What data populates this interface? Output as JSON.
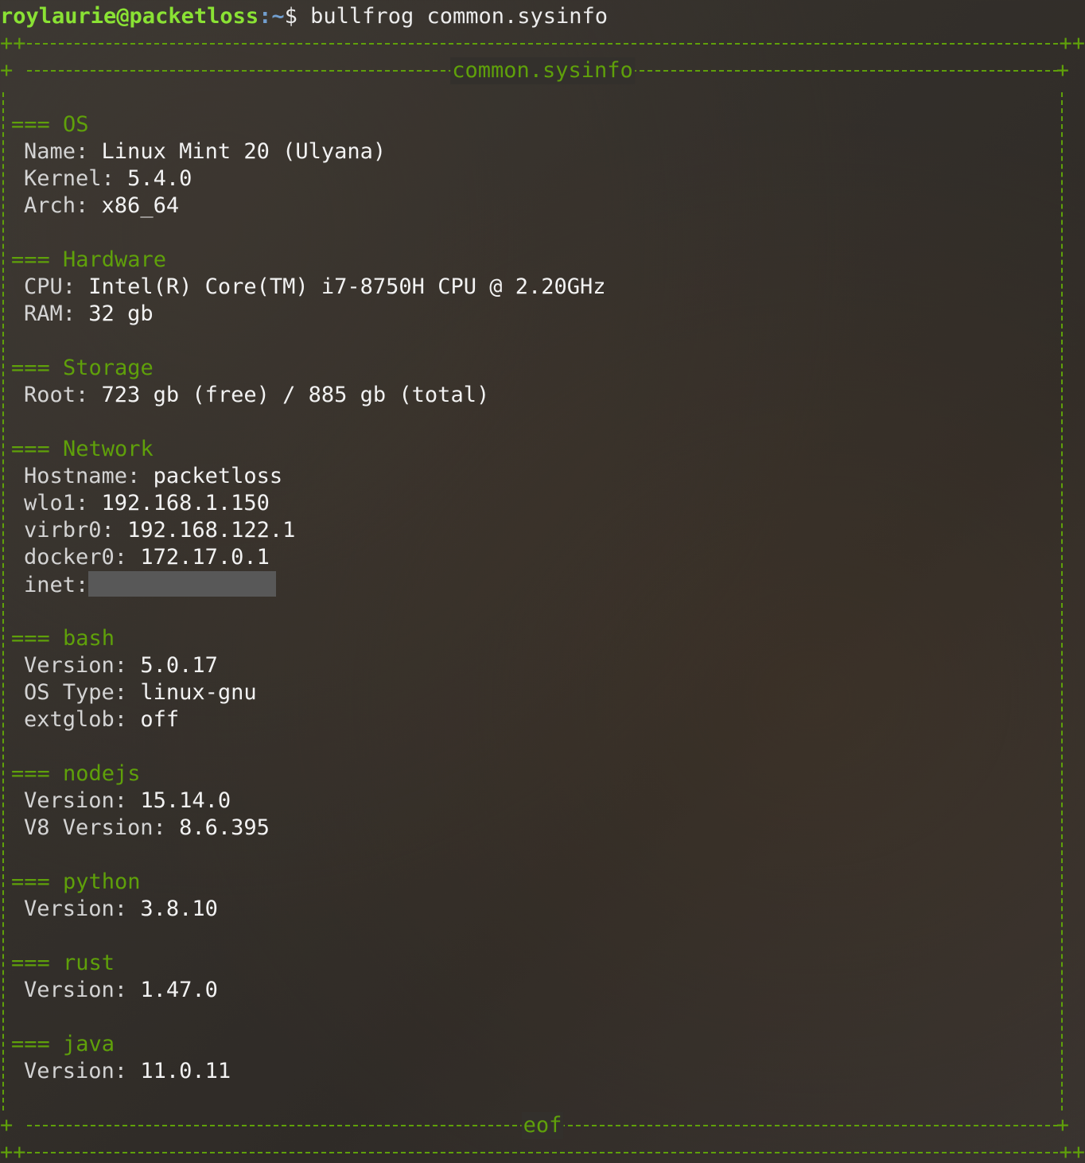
{
  "prompt": {
    "user_host": "roylaurie@packetloss",
    "path": ":~",
    "symbol": "$",
    "command": "bullfrog common.sysinfo"
  },
  "header": {
    "top_rule_left": "++",
    "top_rule_right": "++",
    "title": "common.sysinfo",
    "corner": "+"
  },
  "footer": {
    "title": "eof",
    "corner": "+",
    "bottom_rule_left": "++",
    "bottom_rule_right": "++"
  },
  "sections": {
    "os": {
      "heading": "=== OS",
      "name_key": "Name:",
      "name_val": "Linux Mint 20 (Ulyana)",
      "kernel_key": "Kernel:",
      "kernel_val": "5.4.0",
      "arch_key": "Arch:",
      "arch_val": "x86_64"
    },
    "hardware": {
      "heading": "=== Hardware",
      "cpu_key": "CPU:",
      "cpu_val": "Intel(R) Core(TM) i7-8750H CPU @ 2.20GHz",
      "ram_key": "RAM:",
      "ram_val": "32 gb"
    },
    "storage": {
      "heading": "=== Storage",
      "root_key": "Root:",
      "root_val": "723 gb (free) / 885 gb (total)"
    },
    "network": {
      "heading": "=== Network",
      "hostname_key": "Hostname:",
      "hostname_val": "packetloss",
      "wlo1_key": "wlo1:",
      "wlo1_val": "192.168.1.150",
      "virbr0_key": "virbr0:",
      "virbr0_val": "192.168.122.1",
      "docker0_key": "docker0:",
      "docker0_val": "172.17.0.1",
      "inet_key": "inet:"
    },
    "bash": {
      "heading": "=== bash",
      "version_key": "Version:",
      "version_val": "5.0.17",
      "ostype_key": "OS Type:",
      "ostype_val": "linux-gnu",
      "extglob_key": "extglob:",
      "extglob_val": "off"
    },
    "nodejs": {
      "heading": "=== nodejs",
      "version_key": "Version:",
      "version_val": "15.14.0",
      "v8_key": "V8 Version:",
      "v8_val": "8.6.395"
    },
    "python": {
      "heading": "=== python",
      "version_key": "Version:",
      "version_val": "3.8.10"
    },
    "rust": {
      "heading": "=== rust",
      "version_key": "Version:",
      "version_val": "1.47.0"
    },
    "java": {
      "heading": "=== java",
      "version_key": "Version:",
      "version_val": "11.0.11"
    }
  },
  "colors": {
    "accent_green": "#5fa00a",
    "prompt_green": "#8ae234",
    "prompt_blue": "#729fcf"
  }
}
